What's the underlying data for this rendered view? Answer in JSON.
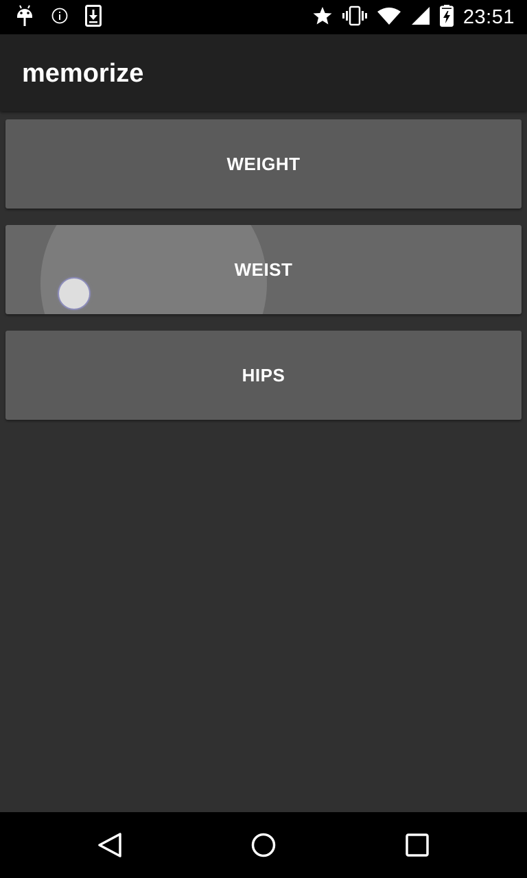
{
  "status_bar": {
    "time": "23:51",
    "left_icons": [
      "android-debug-icon",
      "info-icon",
      "download-icon"
    ],
    "right_icons": [
      "star-icon",
      "vibrate-icon",
      "wifi-icon",
      "signal-icon",
      "battery-charging-icon"
    ]
  },
  "app_bar": {
    "title": "memorize"
  },
  "buttons": [
    {
      "label": "WEIGHT"
    },
    {
      "label": "WEIST",
      "state": "pressed"
    },
    {
      "label": "HIPS"
    }
  ],
  "nav_bar": {
    "icons": [
      "back-icon",
      "home-icon",
      "recents-icon"
    ]
  },
  "colors": {
    "status_bar_bg": "#000000",
    "app_bar_bg": "#212121",
    "background": "#303030",
    "button_bg": "#5b5b5b",
    "button_pressed_bg": "#676767",
    "text": "#ffffff"
  }
}
